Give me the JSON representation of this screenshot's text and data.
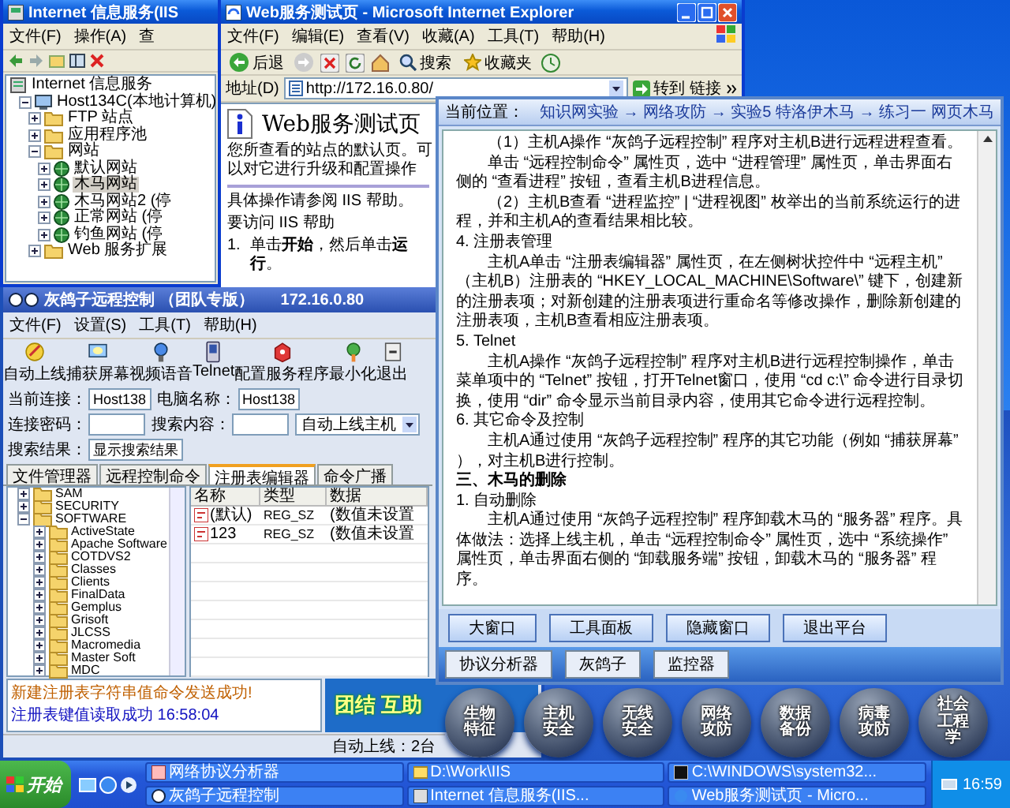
{
  "iis_window": {
    "title": "Internet 信息服务(IIS",
    "menu": [
      "文件(F)",
      "操作(A)",
      "查"
    ],
    "tree": [
      {
        "label": "Internet 信息服务",
        "kind": "root",
        "selected": false,
        "children": [
          {
            "label": "Host134C(本地计算机)",
            "kind": "computer",
            "expanded": true,
            "selected": false,
            "children": [
              {
                "label": "FTP 站点",
                "kind": "folder",
                "expanded": false,
                "selected": false
              },
              {
                "label": "应用程序池",
                "kind": "folder",
                "expanded": false,
                "selected": false
              },
              {
                "label": "网站",
                "kind": "folder",
                "expanded": true,
                "selected": false,
                "children": [
                  {
                    "label": "默认网站",
                    "kind": "site",
                    "expanded": false,
                    "selected": false
                  },
                  {
                    "label": "木马网站",
                    "kind": "site",
                    "expanded": false,
                    "selected": true
                  },
                  {
                    "label": "木马网站2 (停",
                    "kind": "site",
                    "expanded": false,
                    "selected": false
                  },
                  {
                    "label": "正常网站 (停",
                    "kind": "site",
                    "expanded": false,
                    "selected": false
                  },
                  {
                    "label": "钓鱼网站 (停",
                    "kind": "site",
                    "expanded": false,
                    "selected": false
                  }
                ]
              },
              {
                "label": "Web 服务扩展",
                "kind": "folder",
                "expanded": false,
                "selected": false
              }
            ]
          }
        ]
      }
    ]
  },
  "ie_window": {
    "title": "Web服务测试页 - Microsoft Internet Explorer",
    "menu": [
      "文件(F)",
      "编辑(E)",
      "查看(V)",
      "收藏(A)",
      "工具(T)",
      "帮助(H)"
    ],
    "back_label": "后退",
    "search_label": "搜索",
    "favorites_label": "收藏夹",
    "address": {
      "label": "地址(D)",
      "value": "http://172.16.0.80/",
      "go": "转到",
      "links": "链接"
    },
    "page": {
      "heading": "Web服务测试页",
      "intro": "您所查看的站点的默认页。可以对它进行升级和配置操作",
      "lines": [
        "具体操作请参阅 IIS 帮助。",
        "要访问 IIS 帮助"
      ],
      "steps": [
        {
          "number": "1.",
          "text": "单击**开始**，然后单击**运行**。"
        }
      ]
    }
  },
  "rat_window": {
    "title": "灰鸽子远程控制 （团队专版）",
    "address": "172.16.0.80",
    "menu": [
      "文件(F)",
      "设置(S)",
      "工具(T)",
      "帮助(H)"
    ],
    "toolbar": [
      "自动上线",
      "捕获屏幕",
      "视频语音",
      "Telnet",
      "配置服务程序",
      "最小化",
      "退出"
    ],
    "fields": [
      {
        "kind": "field",
        "label": "当前连接：",
        "value": "Host138"
      },
      {
        "kind": "field",
        "label": "电脑名称：",
        "value": "Host138"
      },
      {
        "kind": "field",
        "label": "连接密码："
      },
      {
        "kind": "field",
        "label": "搜索内容："
      },
      {
        "kind": "dropdown",
        "value": "自动上线主机"
      },
      {
        "kind": "field",
        "label": "搜索结果：",
        "value": "显示搜索结果"
      }
    ],
    "tabs": [
      {
        "label": "文件管理器",
        "selected": false
      },
      {
        "label": "远程控制命令",
        "selected": false
      },
      {
        "label": "注册表编辑器",
        "selected": true
      },
      {
        "label": "命令广播",
        "selected": false
      }
    ],
    "reg_tree": [
      {
        "label": "SAM",
        "expanded": false
      },
      {
        "label": "SECURITY",
        "expanded": false
      },
      {
        "label": "SOFTWARE",
        "expanded": true,
        "children": [
          {
            "label": "ActiveState",
            "expanded": false
          },
          {
            "label": "Apache Software",
            "expanded": false
          },
          {
            "label": "COTDVS2",
            "expanded": false
          },
          {
            "label": "Classes",
            "expanded": false
          },
          {
            "label": "Clients",
            "expanded": false
          },
          {
            "label": "FinalData",
            "expanded": false
          },
          {
            "label": "Gemplus",
            "expanded": false
          },
          {
            "label": "Grisoft",
            "expanded": false
          },
          {
            "label": "JLCSS",
            "expanded": false
          },
          {
            "label": "Macromedia",
            "expanded": false
          },
          {
            "label": "Master Soft",
            "expanded": false
          },
          {
            "label": "MDC",
            "expanded": false
          }
        ]
      }
    ],
    "table": {
      "columns": [
        "名称",
        "类型",
        "数据"
      ],
      "rows": [
        [
          "(默认)",
          "REG_SZ",
          "(数值未设置"
        ],
        [
          "123",
          "REG_SZ",
          "(数值未设置"
        ]
      ]
    },
    "log": [
      {
        "text": "新建注册表字符串值命令发送成功!",
        "color": "#c06000"
      },
      {
        "text": "注册表键值读取成功 16:58:04",
        "color": "#1010c0"
      }
    ],
    "banner": "团结 互助",
    "status": "自动上线：2台"
  },
  "guide_window": {
    "location_label": "当前位置：",
    "breadcrumb": "知识网实验 → 网络攻防 → 实验5 特洛伊木马 → 练习一 网页木马",
    "paragraphs": [
      {
        "kind": "body",
        "text": "（1）主机A操作 “灰鸽子远程控制” 程序对主机B进行远程进程查看。"
      },
      {
        "kind": "body",
        "text": "单击 “远程控制命令” 属性页，选中 “进程管理” 属性页，单击界面右侧的 “查看进程” 按钮，查看主机B进程信息。"
      },
      {
        "kind": "body",
        "text": "（2）主机B查看 “进程监控” | “进程视图” 枚举出的当前系统运行的进程，并和主机A的查看结果相比较。"
      },
      {
        "kind": "heading",
        "text": "4. 注册表管理"
      },
      {
        "kind": "body",
        "text": "主机A单击 “注册表编辑器” 属性页，在左侧树状控件中 “远程主机” （主机B）注册表的 “HKEY_LOCAL_MACHINE\\Software\\” 键下，创建新的注册表项；对新创建的注册表项进行重命名等修改操作，删除新创建的注册表项，主机B查看相应注册表项。"
      },
      {
        "kind": "heading",
        "text": "5. Telnet"
      },
      {
        "kind": "body",
        "text": "主机A操作 “灰鸽子远程控制” 程序对主机B进行远程控制操作，单击菜单项中的 “Telnet” 按钮，打开Telnet窗口，使用 “cd c:\\” 命令进行目录切换，使用 “dir” 命令显示当前目录内容，使用其它命令进行远程控制。"
      },
      {
        "kind": "heading",
        "text": "6. 其它命令及控制"
      },
      {
        "kind": "body",
        "text": "主机A通过使用 “灰鸽子远程控制” 程序的其它功能（例如 “捕获屏幕” ），对主机B进行控制。"
      },
      {
        "kind": "section",
        "text": "三、木马的删除"
      },
      {
        "kind": "heading",
        "text": "1. 自动删除"
      },
      {
        "kind": "body",
        "text": "主机A通过使用 “灰鸽子远程控制” 程序卸载木马的 “服务器” 程序。具体做法：选择上线主机，单击 “远程控制命令” 属性页，选中 “系统操作” 属性页，单击界面右侧的 “卸载服务端” 按钮，卸载木马的 “服务器” 程序。"
      }
    ],
    "buttons": [
      "大窗口",
      "工具面板",
      "隐藏窗口",
      "退出平台"
    ],
    "tools": [
      "协议分析器",
      "灰鸽子",
      "监控器"
    ]
  },
  "desktop_icons": [
    "生物特征",
    "主机安全",
    "无线安全",
    "网络攻防",
    "数据备份",
    "病毒攻防",
    "社会工程学"
  ],
  "taskbar": {
    "start": "开始",
    "items": [
      "网络协议分析器",
      "D:\\Work\\IIS",
      "C:\\WINDOWS\\system32...",
      "灰鸽子远程控制",
      "Internet 信息服务(IIS...",
      "Web服务测试页 - Micro..."
    ],
    "clock": "16:59"
  }
}
